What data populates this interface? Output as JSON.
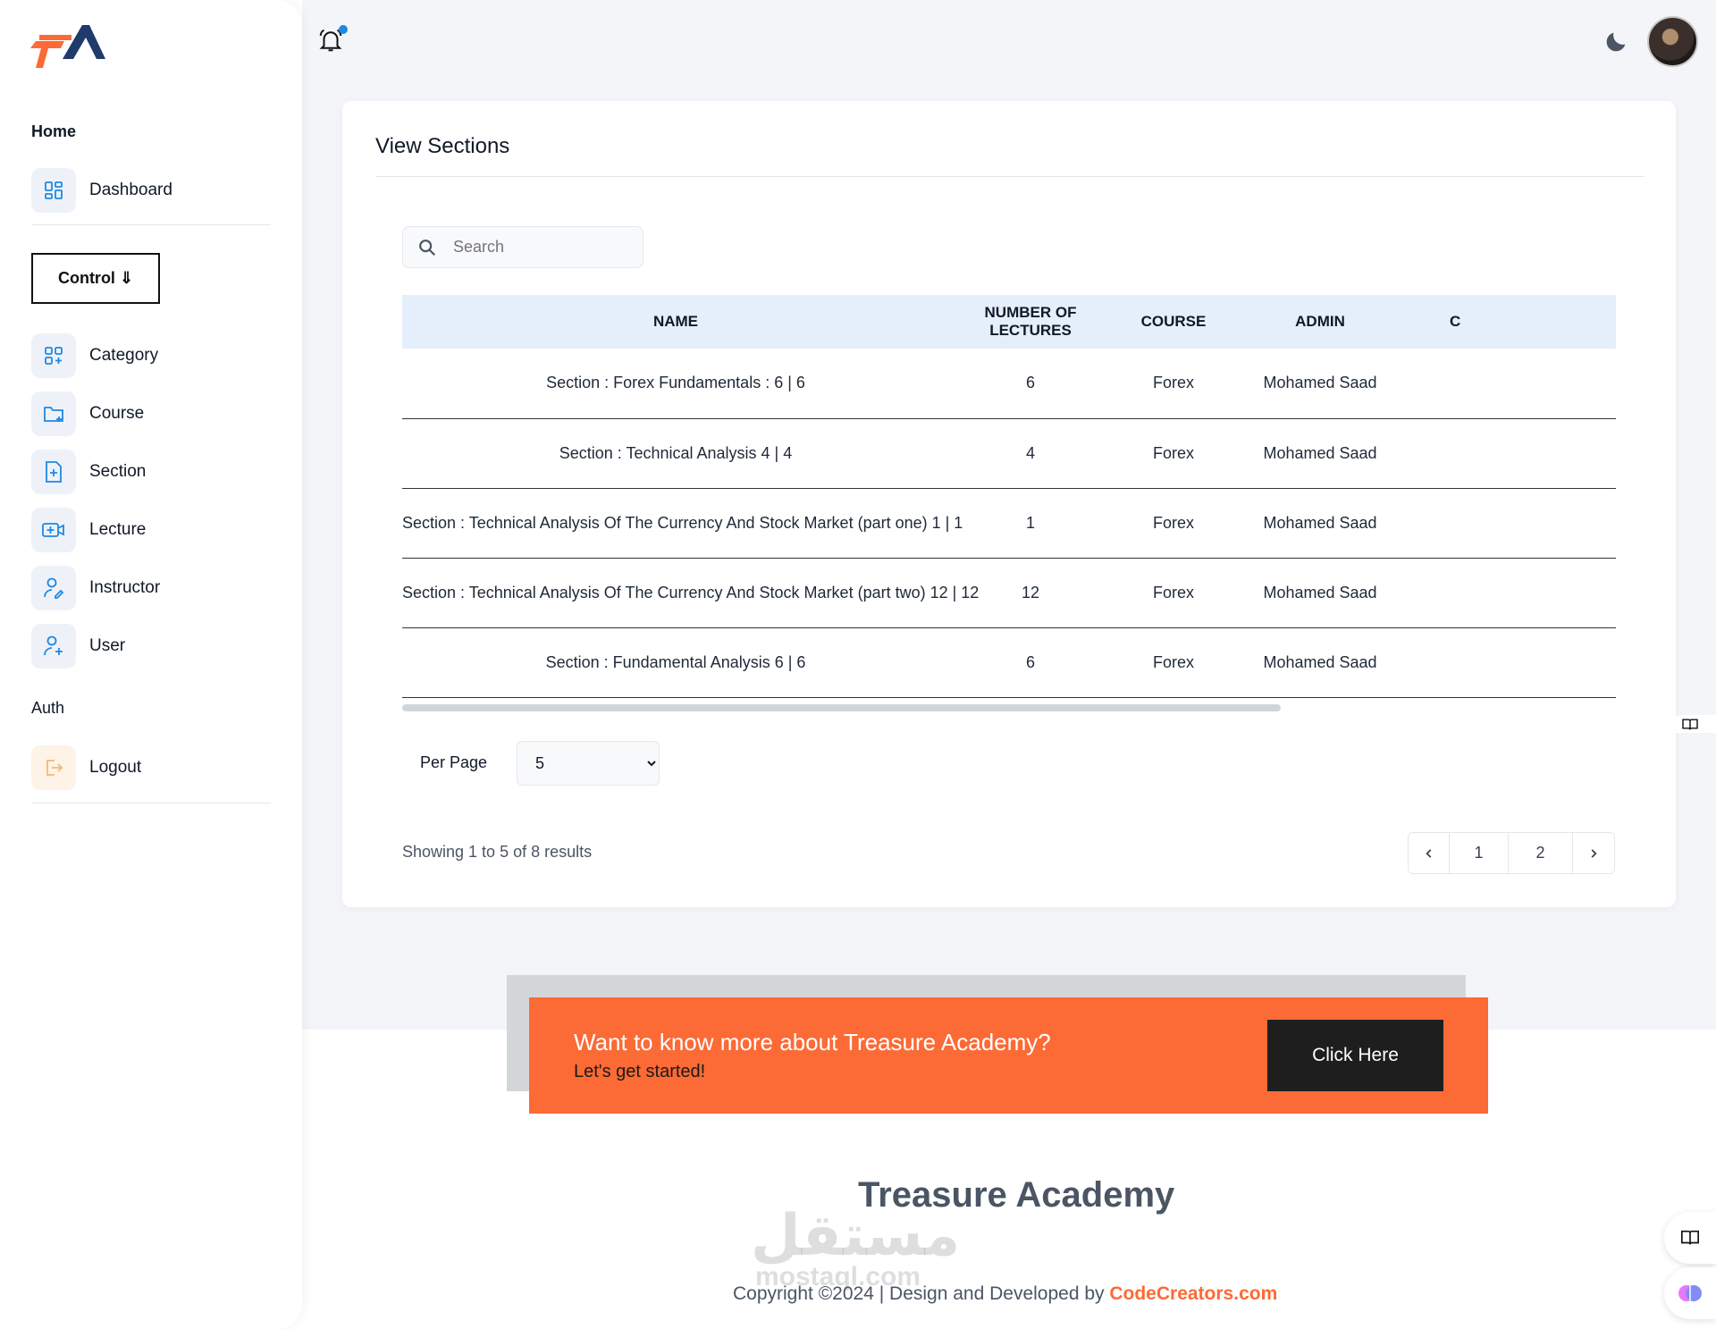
{
  "sidebar": {
    "home_heading": "Home",
    "dashboard_label": "Dashboard",
    "control_label": "Control ⇓",
    "items": [
      {
        "label": "Category"
      },
      {
        "label": "Course"
      },
      {
        "label": "Section"
      },
      {
        "label": "Lecture"
      },
      {
        "label": "Instructor"
      },
      {
        "label": "User"
      }
    ],
    "auth_heading": "Auth",
    "logout_label": "Logout"
  },
  "card": {
    "title": "View Sections",
    "search_placeholder": "Search",
    "columns": [
      "NAME",
      "NUMBER OF LECTURES",
      "COURSE",
      "ADMIN",
      "C"
    ],
    "rows": [
      {
        "name": "Section : Forex Fundamentals : 6 | 6",
        "lectures": "6",
        "course": "Forex",
        "admin": "Mohamed Saad"
      },
      {
        "name": "Section : Technical Analysis 4 | 4",
        "lectures": "4",
        "course": "Forex",
        "admin": "Mohamed Saad"
      },
      {
        "name": "Section : Technical Analysis Of The Currency And Stock Market (part one) 1 | 1",
        "lectures": "1",
        "course": "Forex",
        "admin": "Mohamed Saad"
      },
      {
        "name": "Section : Technical Analysis Of The Currency And Stock Market (part two) 12 | 12",
        "lectures": "12",
        "course": "Forex",
        "admin": "Mohamed Saad"
      },
      {
        "name": "Section : Fundamental Analysis 6 | 6",
        "lectures": "6",
        "course": "Forex",
        "admin": "Mohamed Saad"
      }
    ],
    "per_page_label": "Per Page",
    "per_page_value": "5",
    "showing_text": "Showing 1 to 5 of 8 results",
    "pages": [
      "1",
      "2"
    ]
  },
  "cta": {
    "title": "Want to know more about Treasure Academy?",
    "subtitle": "Let's get started!",
    "button_label": "Click Here"
  },
  "footer": {
    "title": "Treasure Academy",
    "copyright_prefix": "Copyright ©2024 | Design and Developed by ",
    "brand": "CodeCreators.com",
    "watermark": "مستقل",
    "watermark_sub": "mostaql.com"
  },
  "colors": {
    "accent": "#fc6a35",
    "header_row": "#e5eefb",
    "sidebar_icon": "#1e88e5",
    "notification_dot": "#1e88e5"
  }
}
